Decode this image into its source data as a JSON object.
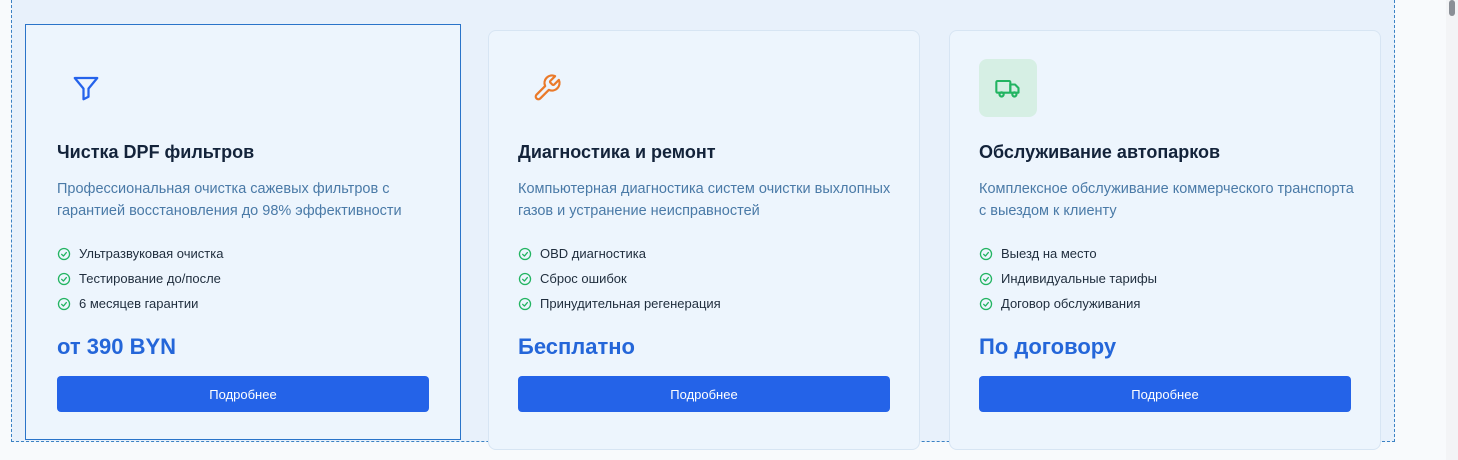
{
  "cards": [
    {
      "icon": "funnel-icon",
      "title": "Чистка DPF фильтров",
      "description": "Профессиональная очистка сажевых фильтров с гарантией восстановления до 98% эффективности",
      "features": [
        "Ультразвуковая очистка",
        "Тестирование до/после",
        "6 месяцев гарантии"
      ],
      "price": "от 390 BYN",
      "button_label": "Подробнее"
    },
    {
      "icon": "wrench-icon",
      "title": "Диагностика и ремонт",
      "description": "Компьютерная диагностика систем очистки выхлопных газов и устранение неисправностей",
      "features": [
        "OBD диагностика",
        "Сброс ошибок",
        "Принудительная регенерация"
      ],
      "price": "Бесплатно",
      "button_label": "Подробнее"
    },
    {
      "icon": "truck-icon",
      "title": "Обслуживание автопарков",
      "description": "Комплексное обслуживание коммерческого транспорта с выездом к клиенту",
      "features": [
        "Выезд на место",
        "Индивидуальные тарифы",
        "Договор обслуживания"
      ],
      "price": "По договору",
      "button_label": "Подробнее"
    }
  ],
  "colors": {
    "accent": "#2463e8",
    "funnel": "#2563eb",
    "wrench": "#ea7a2a",
    "truck": "#22b461",
    "check": "#22b461"
  }
}
